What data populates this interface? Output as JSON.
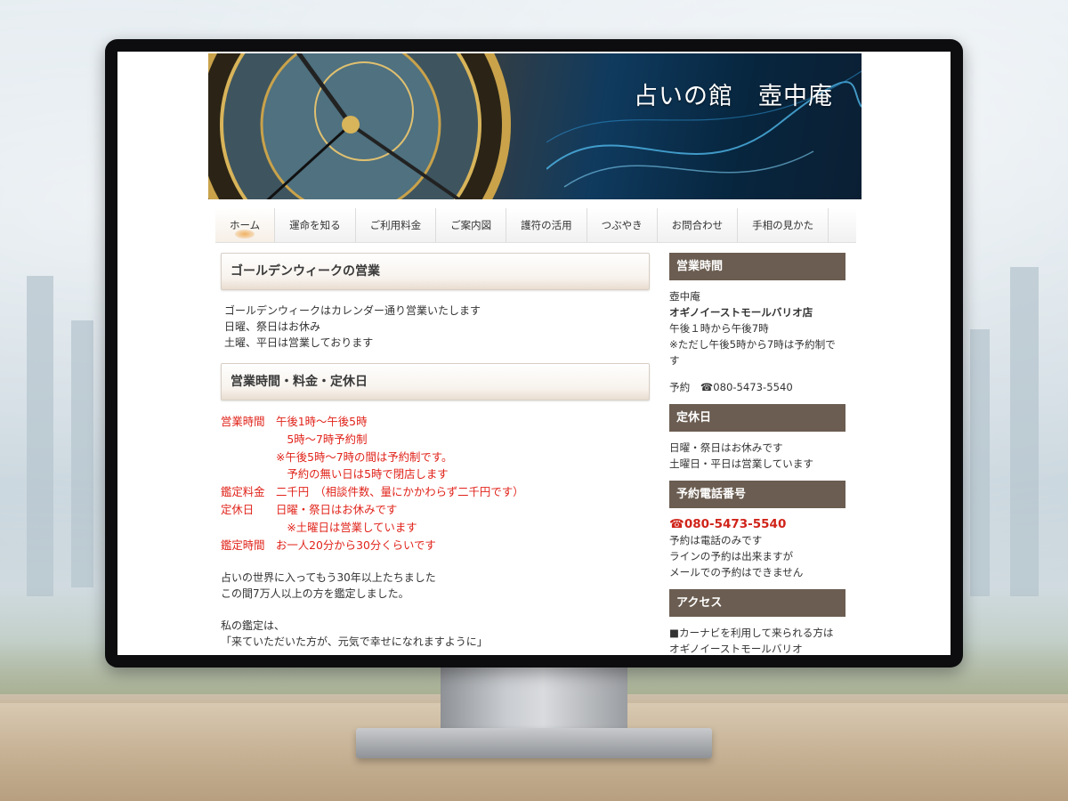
{
  "site_title": "占いの館　壺中庵",
  "nav": [
    {
      "label": "ホーム",
      "active": true
    },
    {
      "label": "運命を知る"
    },
    {
      "label": "ご利用料金"
    },
    {
      "label": "ご案内図"
    },
    {
      "label": "護符の活用"
    },
    {
      "label": "つぶやき"
    },
    {
      "label": "お問合わせ"
    },
    {
      "label": "手相の見かた"
    }
  ],
  "main": {
    "gw_heading": "ゴールデンウィークの営業",
    "gw_lines": [
      "ゴールデンウィークはカレンダー通り営業いたします",
      "日曜、祭日はお休み",
      "土曜、平日は営業しております"
    ],
    "hours_heading": "営業時間・料金・定休日",
    "hours_lines": [
      "営業時間　午後1時～午後5時",
      "　　　　　　5時～7時予約制",
      "　　　　　※午後5時～7時の間は予約制です。",
      "　　　　　　予約の無い日は5時で閉店します",
      "鑑定料金　二千円　（相談件数、量にかかわらず二千円です）",
      "定休日　　日曜・祭日はお休みです",
      "　　　　　　※土曜日は営業しています",
      "鑑定時間　お一人20分から30分くらいです"
    ],
    "intro_lines": [
      "占いの世界に入ってもう30年以上たちました",
      "この間7万人以上の方を鑑定しました。"
    ],
    "closing_lines": [
      "私の鑑定は、",
      "「来ていただいた方が、元気で幸せになれますように」"
    ]
  },
  "sidebar": {
    "hours_heading": "営業時間",
    "shop_name": "壺中庵",
    "shop_location": "オギノイーストモールバリオ店",
    "hours_line": "午後１時から午後7時",
    "hours_note": "※ただし午後5時から7時は予約制です",
    "reservation": "予約　☎080-5473-5540",
    "closed_heading": "定休日",
    "closed_lines": [
      "日曜・祭日はお休みです",
      "土曜日・平日は営業しています"
    ],
    "phone_heading": "予約電話番号",
    "phone": "☎080-5473-5540",
    "phone_lines": [
      "予約は電話のみです",
      "ラインの予約は出来ますが",
      "メールでの予約はできません"
    ],
    "access_heading": "アクセス",
    "access_lines": [
      "■カーナビを利用して来られる方は",
      "オギノイーストモールバリオ"
    ]
  },
  "colors": {
    "accent_red": "#e0231a",
    "sidebar_heading_bg": "#6b5d51"
  }
}
